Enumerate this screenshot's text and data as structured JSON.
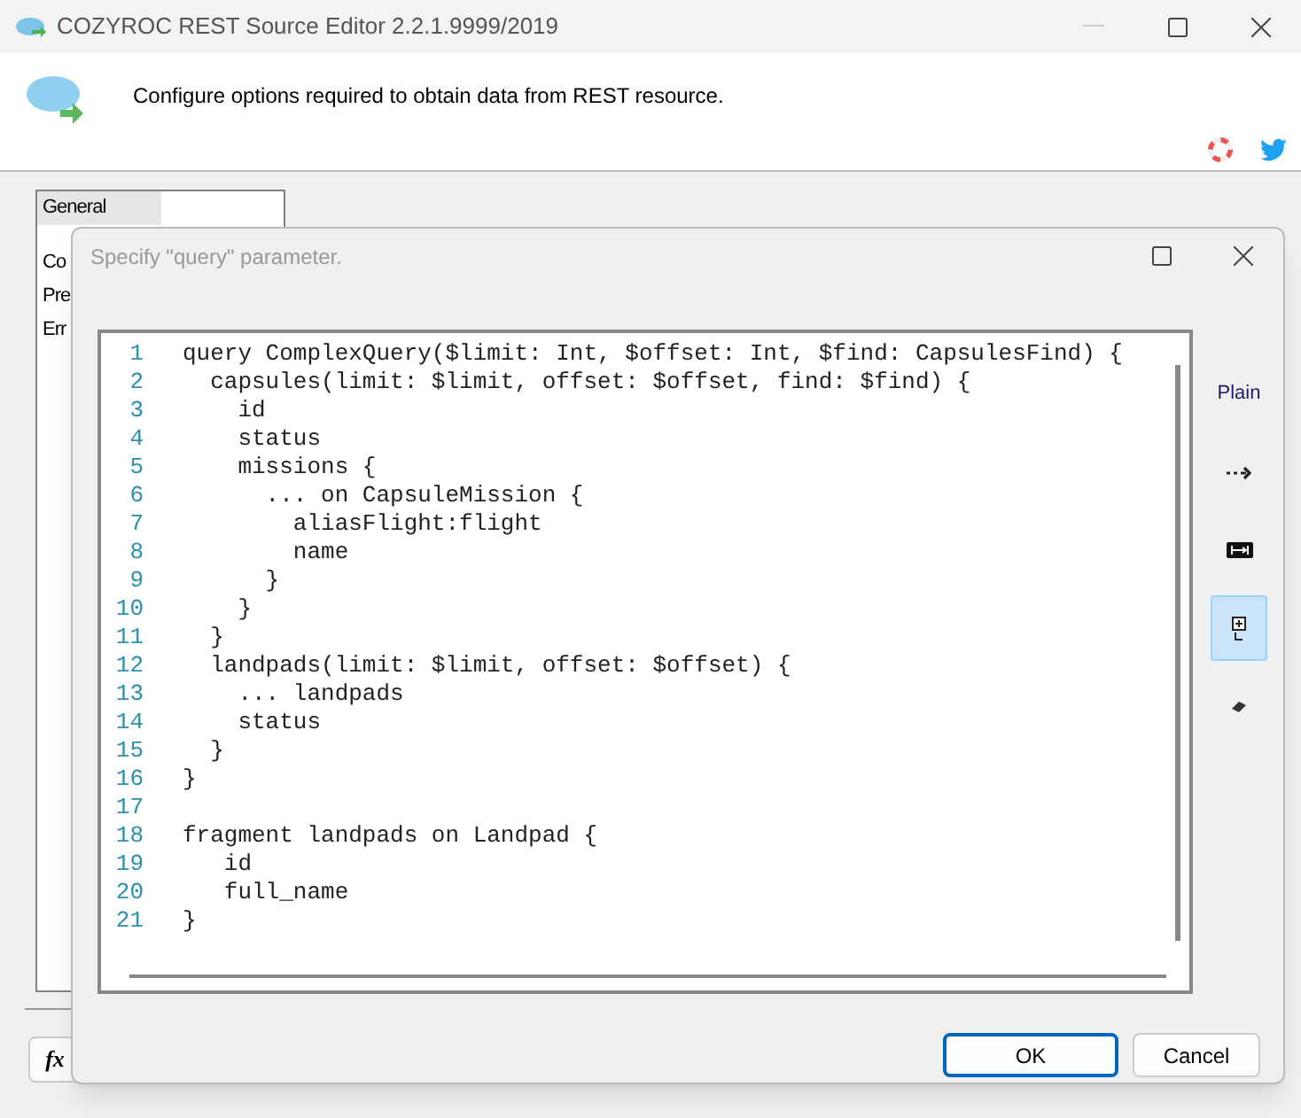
{
  "window": {
    "title": "COZYROC REST Source Editor 2.2.1.9999/2019"
  },
  "header": {
    "message": "Configure options required to obtain data from REST resource."
  },
  "sidebar": {
    "items": [
      {
        "label": "General",
        "selected": true
      },
      {
        "label": "Co",
        "selected": false
      },
      {
        "label": "Pre",
        "selected": false
      },
      {
        "label": "Err",
        "selected": false
      }
    ]
  },
  "bottom_buttons": [
    {
      "label": "fx"
    }
  ],
  "dialog": {
    "title": "Specify \"query\" parameter.",
    "code_lines": [
      {
        "number": "1",
        "text": "query ComplexQuery($limit: Int, $offset: Int, $find: CapsulesFind) {"
      },
      {
        "number": "2",
        "text": "  capsules(limit: $limit, offset: $offset, find: $find) {"
      },
      {
        "number": "3",
        "text": "    id"
      },
      {
        "number": "4",
        "text": "    status"
      },
      {
        "number": "5",
        "text": "    missions {"
      },
      {
        "number": "6",
        "text": "      ... on CapsuleMission {"
      },
      {
        "number": "7",
        "text": "        aliasFlight:flight"
      },
      {
        "number": "8",
        "text": "        name"
      },
      {
        "number": "9",
        "text": "      }"
      },
      {
        "number": "10",
        "text": "    }"
      },
      {
        "number": "11",
        "text": "  }"
      },
      {
        "number": "12",
        "text": "  landpads(limit: $limit, offset: $offset) {"
      },
      {
        "number": "13",
        "text": "    ... landpads"
      },
      {
        "number": "14",
        "text": "    status"
      },
      {
        "number": "15",
        "text": "  }"
      },
      {
        "number": "16",
        "text": "}"
      },
      {
        "number": "17"
      },
      {
        "number": "18",
        "text": "fragment landpads on Landpad {"
      },
      {
        "number": "19",
        "text": "   id"
      },
      {
        "number": "20",
        "text": "   full_name"
      },
      {
        "number": "21",
        "text": "}"
      }
    ],
    "tools": [
      {
        "kind": "text",
        "label": "Plain",
        "selected": false
      },
      {
        "kind": "arrow",
        "selected": false
      },
      {
        "kind": "tabs",
        "selected": false
      },
      {
        "kind": "expand",
        "selected": true
      },
      {
        "kind": "eraser",
        "selected": false
      }
    ],
    "buttons": [
      {
        "label": "OK",
        "default": true
      },
      {
        "label": "Cancel",
        "default": false
      }
    ]
  }
}
